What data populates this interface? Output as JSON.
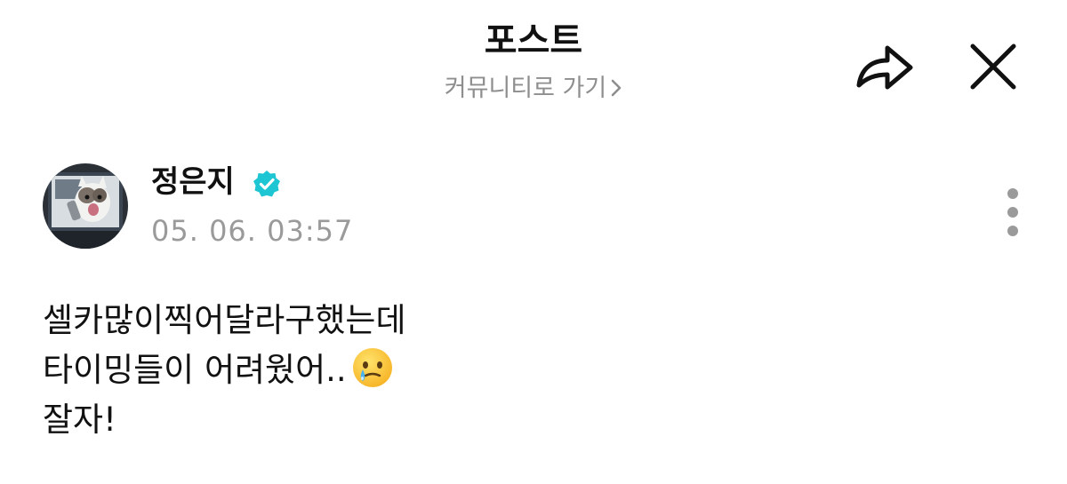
{
  "header": {
    "title": "포스트",
    "community_link_label": "커뮤니티로 가기"
  },
  "icons": {
    "share": "share-arrow-icon",
    "close": "close-icon",
    "more": "more-vertical-icon",
    "verified": "verified-badge-icon",
    "chevron": "chevron-right-icon",
    "emoji": "face-holding-back-tears-emoji"
  },
  "post": {
    "author": "정은지",
    "timestamp": "05. 06. 03:57",
    "lines": [
      "셀카많이찍어달라구했는데",
      "타이밍들이 어려웠어..",
      "잘자!"
    ]
  },
  "colors": {
    "background": "#ffffff",
    "text": "#111111",
    "muted": "#8e8e8e",
    "verified": "#1ec6d3"
  }
}
